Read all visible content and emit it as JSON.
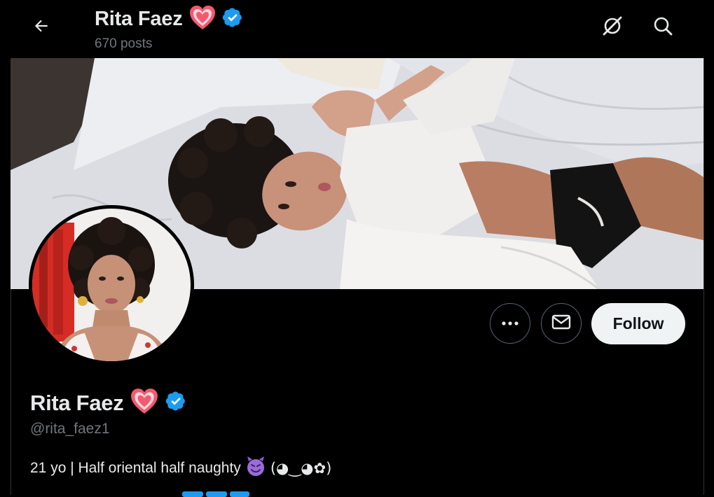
{
  "header": {
    "name": "Rita Faez",
    "posts_count": "670 posts",
    "back_icon": "arrow-left-icon",
    "grok_icon": "grok-icon",
    "search_icon": "search-icon"
  },
  "profile": {
    "display_name": "Rita Faez",
    "handle": "@rita_faez1",
    "bio_text": "21 yo | Half oriental half naughty",
    "bio_kaomoji": "(◕‿◕✿)",
    "name_emoji": "heart-icon",
    "verified_icon": "verified-badge-icon",
    "bio_emoji": "smiling-devil-icon"
  },
  "actions": {
    "more_icon": "more-dots-icon",
    "message_icon": "mail-icon",
    "follow_label": "Follow"
  },
  "colors": {
    "background": "#000000",
    "text_primary": "#e7e9ea",
    "text_secondary": "#71767b",
    "verified": "#1d9bf0",
    "heart": "#f4596e",
    "follow_bg": "#eff3f4"
  }
}
